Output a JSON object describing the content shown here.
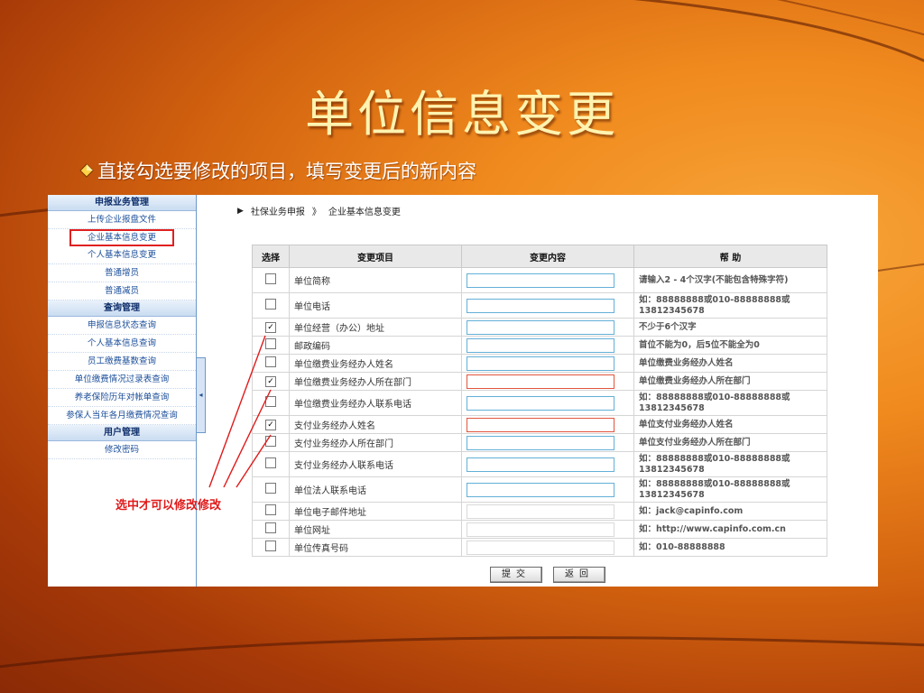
{
  "slide": {
    "title": "单位信息变更",
    "bullet": "直接勾选要修改的项目，填写变更后的新内容"
  },
  "sidebar": {
    "sections": [
      {
        "head": "申报业务管理",
        "items": [
          "上传企业报盘文件",
          "企业基本信息变更",
          "个人基本信息变更",
          "普通增员",
          "普通减员"
        ]
      },
      {
        "head": "查询管理",
        "items": [
          "申报信息状态查询",
          "个人基本信息查询",
          "员工缴费基数查询",
          "单位缴费情况过录表查询",
          "养老保险历年对帐单查询",
          "参保人当年各月缴费情况查询"
        ]
      },
      {
        "head": "用户管理",
        "items": [
          "修改密码"
        ]
      }
    ],
    "toggle_glyph": "◂"
  },
  "breadcrumb": {
    "part1": "社保业务申报",
    "sep": "》",
    "part2": "企业基本信息变更"
  },
  "table": {
    "headers": [
      "选择",
      "变更项目",
      "变更内容",
      "帮  助"
    ],
    "rows": [
      {
        "checked": false,
        "item": "单位简称",
        "field": "blue",
        "help": "请输入2 - 4个汉字(不能包含特殊字符)"
      },
      {
        "checked": false,
        "item": "单位电话",
        "field": "blue",
        "help": "如：88888888或010-88888888或13812345678"
      },
      {
        "checked": true,
        "item": "单位经营（办公）地址",
        "field": "blue",
        "help": "不少于6个汉字"
      },
      {
        "checked": false,
        "item": "邮政编码",
        "field": "blue",
        "help": "首位不能为0，后5位不能全为0"
      },
      {
        "checked": false,
        "item": "单位缴费业务经办人姓名",
        "field": "blue",
        "help": "单位缴费业务经办人姓名"
      },
      {
        "checked": true,
        "item": "单位缴费业务经办人所在部门",
        "field": "red",
        "help": "单位缴费业务经办人所在部门"
      },
      {
        "checked": false,
        "item": "单位缴费业务经办人联系电话",
        "field": "blue",
        "help": "如：88888888或010-88888888或13812345678"
      },
      {
        "checked": true,
        "item": "支付业务经办人姓名",
        "field": "red",
        "help": "单位支付业务经办人姓名"
      },
      {
        "checked": false,
        "item": "支付业务经办人所在部门",
        "field": "blue",
        "help": "单位支付业务经办人所在部门"
      },
      {
        "checked": false,
        "item": "支付业务经办人联系电话",
        "field": "blue",
        "help": "如：88888888或010-88888888或13812345678"
      },
      {
        "checked": false,
        "item": "单位法人联系电话",
        "field": "blue",
        "help": "如：88888888或010-88888888或13812345678"
      },
      {
        "checked": false,
        "item": "单位电子邮件地址",
        "field": "plain",
        "help": "如：jack@capinfo.com"
      },
      {
        "checked": false,
        "item": "单位网址",
        "field": "plain",
        "help": "如：http://www.capinfo.com.cn"
      },
      {
        "checked": false,
        "item": "单位传真号码",
        "field": "plain",
        "help": "如：010-88888888"
      }
    ]
  },
  "buttons": {
    "submit": "提交",
    "back": "返回"
  },
  "annotation": "选中才可以修改修改",
  "colors": {
    "accent_red": "#e01a1a",
    "title": "#fff3b0",
    "sidebar_link": "#1c4f9a"
  }
}
